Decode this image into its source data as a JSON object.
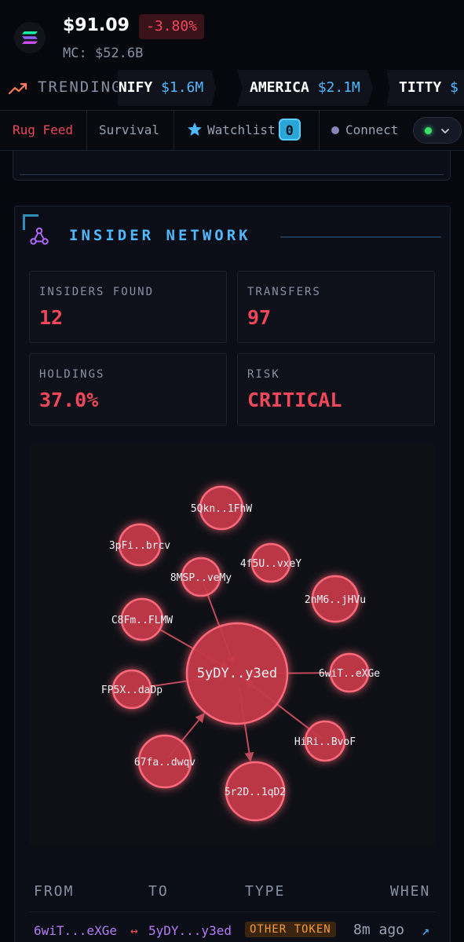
{
  "header": {
    "price": "$91.09",
    "change": "-3.80%",
    "market_cap": "MC: $52.6B"
  },
  "trending": {
    "label": "TRENDING",
    "chips": [
      {
        "name": "INIFY",
        "amount": "$1.6M"
      },
      {
        "name": "AMERICA",
        "amount": "$2.1M"
      },
      {
        "name": "TITTY",
        "amount": "$"
      }
    ]
  },
  "nav": {
    "rug_feed": "Rug Feed",
    "survival": "Survival",
    "watchlist": "Watchlist",
    "watchlist_count": "0",
    "connect": "Connect"
  },
  "insider": {
    "title": "INSIDER NETWORK",
    "stats": [
      {
        "label": "INSIDERS FOUND",
        "value": "12"
      },
      {
        "label": "TRANSFERS",
        "value": "97"
      },
      {
        "label": "HOLDINGS",
        "value": "37.0%"
      },
      {
        "label": "RISK",
        "value": "CRITICAL"
      }
    ],
    "graph": {
      "center": "5yDY..y3ed",
      "nodes": [
        "5Qkn..1FhW",
        "3pFi..brcv",
        "4f5U..vxeY",
        "8MSP..veMy",
        "2nM6..jHVu",
        "C8Fm..FLMW",
        "6wiT..eXGe",
        "FP5X..daDp",
        "HiRi..BvoF",
        "67fa..dwqv",
        "5r2D..1qD2"
      ]
    },
    "table": {
      "headers": [
        "FROM",
        "TO",
        "TYPE",
        "WHEN"
      ],
      "rows": [
        {
          "from": "6wiT...eXGe",
          "arrow": "↔",
          "to": "5yDY...y3ed",
          "type": "OTHER TOKEN",
          "when": "8m ago",
          "link": "↗"
        }
      ]
    }
  },
  "colors": {
    "accent": "#4fb8ff",
    "danger": "#f0485a",
    "node": "#c43848"
  }
}
